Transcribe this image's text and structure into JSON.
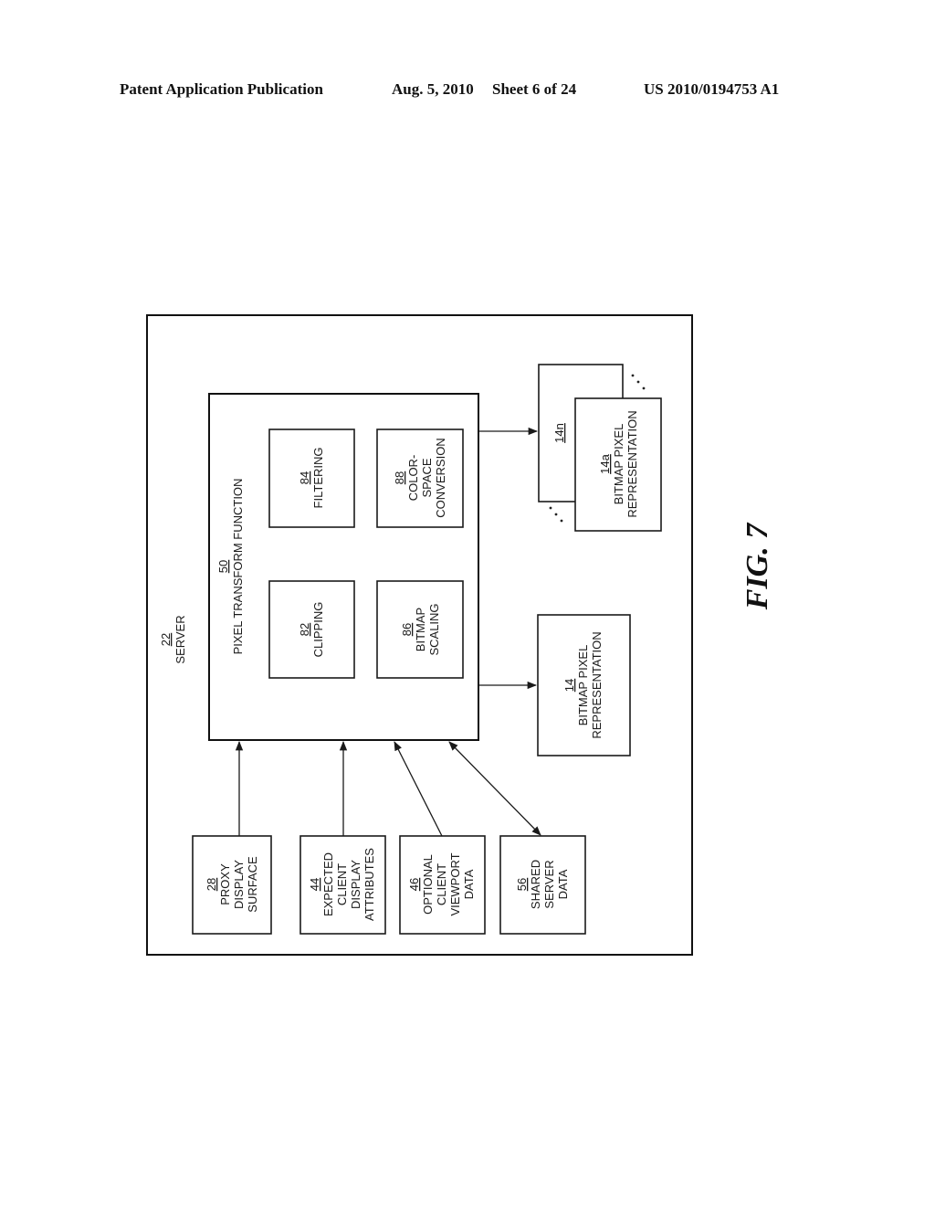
{
  "header": {
    "publication_type": "Patent Application Publication",
    "date": "Aug. 5, 2010",
    "sheet": "Sheet 6 of 24",
    "publication_number": "US 2010/0194753 A1"
  },
  "figure": {
    "label": "FIG. 7",
    "server": {
      "ref": "22",
      "label": "SERVER"
    },
    "pixel_transform": {
      "ref": "50",
      "label": "PIXEL TRANSFORM FUNCTION",
      "functions": [
        {
          "ref": "82",
          "lines": [
            "CLIPPING"
          ]
        },
        {
          "ref": "84",
          "lines": [
            "FILTERING"
          ]
        },
        {
          "ref": "86",
          "lines": [
            "BITMAP",
            "SCALING"
          ]
        },
        {
          "ref": "88",
          "lines": [
            "COLOR-",
            "SPACE",
            "CONVERSION"
          ]
        }
      ]
    },
    "outputs": {
      "single": {
        "ref": "14",
        "lines": [
          "BITMAP PIXEL",
          "REPRESENTATION"
        ]
      },
      "stack_back": {
        "ref": "14n"
      },
      "stack_front": {
        "ref": "14a",
        "lines": [
          "BITMAP PIXEL",
          "REPRESENTATION"
        ]
      },
      "ellipsis": "..."
    },
    "inputs": [
      {
        "ref": "28",
        "lines": [
          "PROXY",
          "DISPLAY",
          "SURFACE"
        ],
        "connection": "one-way"
      },
      {
        "ref": "44",
        "lines": [
          "EXPECTED",
          "CLIENT",
          "DISPLAY",
          "ATTRIBUTES"
        ],
        "connection": "one-way"
      },
      {
        "ref": "46",
        "lines": [
          "OPTIONAL",
          "CLIENT",
          "VIEWPORT",
          "DATA"
        ],
        "connection": "one-way"
      },
      {
        "ref": "56",
        "lines": [
          "SHARED",
          "SERVER",
          "DATA"
        ],
        "connection": "two-way"
      }
    ]
  }
}
